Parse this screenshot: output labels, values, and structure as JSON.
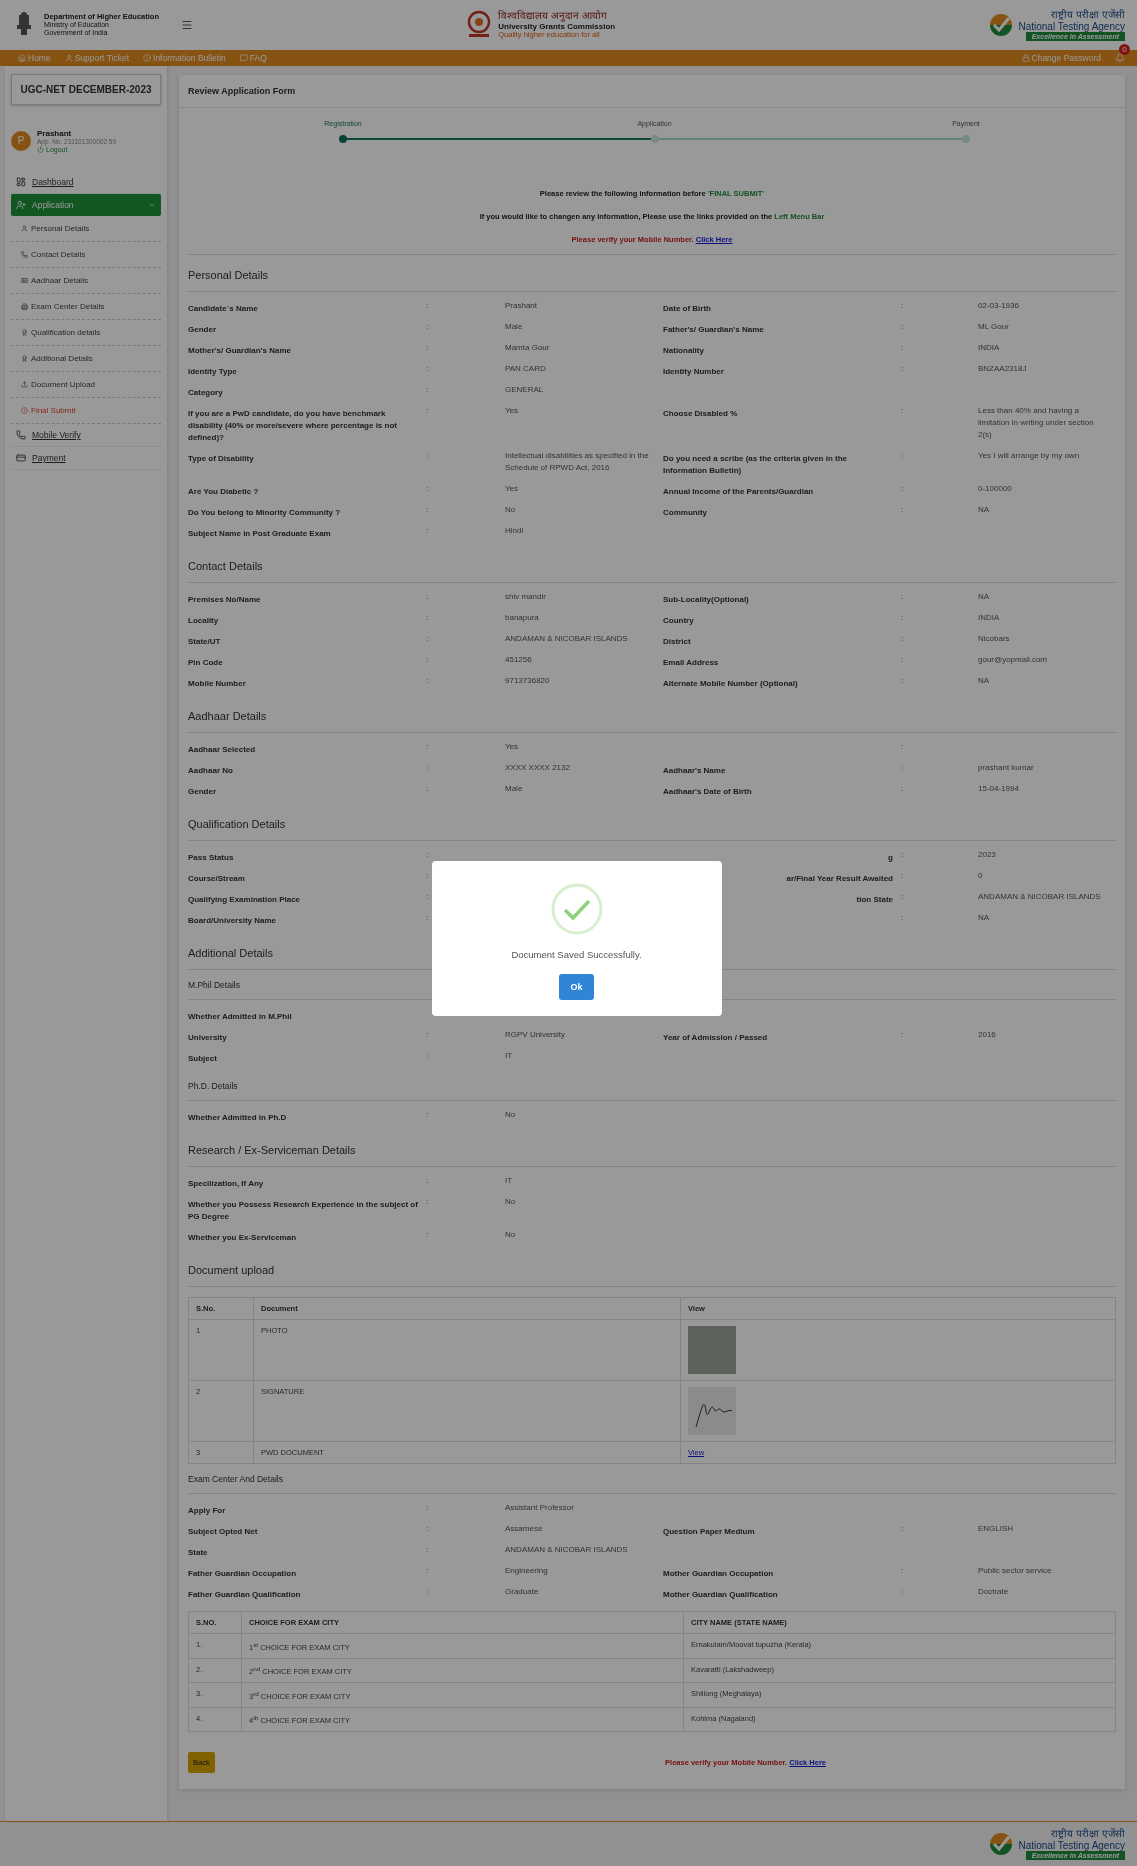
{
  "header": {
    "department": [
      "Department of Higher Education",
      "Ministry of Education",
      "Government of India"
    ],
    "center": {
      "hindi": "विश्वविद्यालय अनुदान आयोग",
      "name": "University Grants Commission",
      "tagline": "Quality higher education for all"
    },
    "right": {
      "hindi": "राष्ट्रीय परीक्षा एजेंसी",
      "name": "National Testing Agency",
      "tagline": "Excellence in Assessment"
    }
  },
  "nav": {
    "items": [
      {
        "label": "Home"
      },
      {
        "label": "Support Ticket"
      },
      {
        "label": "Information Bulletin"
      },
      {
        "label": "FAQ"
      }
    ],
    "change_password": "Change Password",
    "notifications": "0"
  },
  "sidebar": {
    "exam": "UGC-NET DECEMBER-2023",
    "user": {
      "name": "Prashant",
      "initial": "P",
      "app_no": "App. No. 231101300002 59",
      "logout": "Logout"
    },
    "items": [
      {
        "label": "Dashboard",
        "kind": "link",
        "selected": false
      },
      {
        "label": "Application",
        "kind": "group",
        "selected": true,
        "expanded": true,
        "children": [
          {
            "label": "Personal Details",
            "kind": "step"
          },
          {
            "label": "Contact Details",
            "kind": "step"
          },
          {
            "label": "Aadhaar Details",
            "kind": "step"
          },
          {
            "label": "Exam Center Details",
            "kind": "step"
          },
          {
            "label": "Qualification details",
            "kind": "step"
          },
          {
            "label": "Additional Details",
            "kind": "step"
          },
          {
            "label": "Document Upload",
            "kind": "step"
          },
          {
            "label": "Final Submit",
            "kind": "final"
          }
        ]
      },
      {
        "label": "Mobile Verify",
        "kind": "link",
        "selected": false
      },
      {
        "label": "Payment",
        "kind": "link",
        "selected": false
      }
    ]
  },
  "main": {
    "title": "Review Application Form",
    "steps": [
      {
        "label": "Registration",
        "completed": true
      },
      {
        "label": "Application",
        "completed": false
      },
      {
        "label": "Payment",
        "completed": false
      }
    ],
    "notices": [
      {
        "text": "Please review the following information before ",
        "highlight": "'FINAL SUBMIT'"
      },
      {
        "text": "If you would like to changen any information, Please use the links provided on the ",
        "highlight": "Left Menu Bar"
      }
    ],
    "verify": {
      "text": "Please verify your Mobile Number.",
      "link": "Click Here"
    },
    "sections": [
      {
        "kind": "section",
        "title": "Personal Details",
        "rows": [
          {
            "kind": "pair",
            "label": "Candidate`s Name",
            "sep": ":",
            "value": "Prashant",
            "label2": "Date of Birth",
            "sep2": ":",
            "value2": "02-03-1936"
          },
          {
            "kind": "pair",
            "label": "Gender",
            "sep": ":",
            "value": "Male",
            "label2": "Father's/ Guardian's Name",
            "sep2": ":",
            "value2": "ML Gour"
          },
          {
            "kind": "pair",
            "label": "Mother's/ Guardian's Name",
            "sep": ":",
            "value": "Mamta Gour",
            "label2": "Nationality",
            "sep2": ":",
            "value2": "INDIA"
          },
          {
            "kind": "pair",
            "label": "Identity Type",
            "sep": ":",
            "value": "PAN CARD",
            "label2": "Identity Number",
            "sep2": ":",
            "value2": "BNZAA2318J"
          },
          {
            "kind": "single",
            "label": "Category",
            "sep": ":",
            "value": "GENERAL"
          },
          {
            "kind": "pair",
            "label": "If you are a PwD candidate, do you have benchmark disability (40% or more/severe where percentage is not defined)?",
            "sep": ":",
            "value": "Yes",
            "label2": "Choose Disabled %",
            "sep2": ":",
            "value2": "Less than 40% and having a limitation in writing under section 2(s)"
          },
          {
            "kind": "pair",
            "label": "Type of Disability",
            "sep": ":",
            "value": "Intellectual disabilities as specified in the Schedule of RPWD Act, 2016",
            "label2": "Do you need a scribe (as the criteria given in the Information Bulletin)",
            "sep2": ":",
            "value2": "Yes I will arrange by my own"
          },
          {
            "kind": "pair",
            "label": "Are You Diabetic ?",
            "sep": ":",
            "value": "Yes",
            "label2": "Annual Income of the Parents/Guardian",
            "sep2": ":",
            "value2": "0-100000"
          },
          {
            "kind": "pair",
            "label": "Do You belong to Minority Community ?",
            "sep": ":",
            "value": "No",
            "label2": "Community",
            "sep2": ":",
            "value2": "NA"
          },
          {
            "kind": "single",
            "label": "Subject Name in Post Graduate Exam",
            "sep": ":",
            "value": "Hindi"
          }
        ]
      },
      {
        "kind": "section",
        "title": "Contact Details",
        "rows": [
          {
            "kind": "pair",
            "label": "Premises No/Name",
            "sep": ":",
            "value": "shiv mandir",
            "label2": "Sub-Locality(Optional)",
            "sep2": ":",
            "value2": "NA"
          },
          {
            "kind": "pair",
            "label": "Locality",
            "sep": ":",
            "value": "banapura",
            "label2": "Country",
            "sep2": ":",
            "value2": "INDIA"
          },
          {
            "kind": "pair",
            "label": "State/UT",
            "sep": ":",
            "value": "ANDAMAN & NICOBAR ISLANDS",
            "label2": "District",
            "sep2": ":",
            "value2": "Nicobars"
          },
          {
            "kind": "pair",
            "label": "Pin Code",
            "sep": ":",
            "value": "451256",
            "label2": "Email Address",
            "sep2": ":",
            "value2": "gour@yopmail.com"
          },
          {
            "kind": "pair",
            "label": "Mobile Number",
            "sep": ":",
            "value": "9713736820",
            "label2": "Alternate Mobile Number (Optional)",
            "sep2": ":",
            "value2": "NA"
          }
        ]
      },
      {
        "kind": "section",
        "title": "Aadhaar Details",
        "rows": [
          {
            "kind": "pair",
            "label": "Aadhaar Selected",
            "sep": ":",
            "value": "Yes",
            "sep2": ":"
          },
          {
            "kind": "pair",
            "label": "Aadhaar No",
            "sep": ":",
            "value": "XXXX XXXX 2132",
            "label2": "Aadhaar's Name",
            "sep2": ":",
            "value2": "prashant kumar"
          },
          {
            "kind": "pair",
            "label": "Gender",
            "sep": ":",
            "value": "Male",
            "label2": "Aadhaar's Date of Birth",
            "sep2": ":",
            "value2": "15-04-1994"
          }
        ]
      },
      {
        "kind": "section",
        "title": "Qualification Details",
        "rows": [
          {
            "kind": "covered",
            "label": "Pass Status",
            "sep": ":",
            "label2": "g",
            "sep2": ":",
            "value2": "2023"
          },
          {
            "kind": "covered",
            "label": "Course/Stream",
            "sep": ":",
            "label2": "ar/Final Year Result Awaited",
            "sep2": ":",
            "value2": "0"
          },
          {
            "kind": "covered",
            "label": "Qualifying Examination Place",
            "sep": ":",
            "label2": "tion State",
            "sep2": ":",
            "value2": "ANDAMAN & NICOBAR ISLANDS"
          },
          {
            "kind": "covered",
            "label": "Board/University Name",
            "sep": ":",
            "sep2": ":",
            "value2": "NA"
          }
        ]
      },
      {
        "kind": "section",
        "title": "Additional Details"
      },
      {
        "kind": "subsection",
        "title": "M.Phil Details",
        "rows": [
          {
            "kind": "covered",
            "label": "Whether Admitted in M.Phil"
          },
          {
            "kind": "pair",
            "label": "University",
            "sep": ":",
            "value": "RGPV University",
            "label2": "Year of Admission / Passed",
            "sep2": ":",
            "value2": "2016"
          },
          {
            "kind": "single",
            "label": "Subject",
            "sep": ":",
            "value": "IT"
          }
        ]
      },
      {
        "kind": "subsection",
        "title": "Ph.D. Details",
        "rows": [
          {
            "kind": "single",
            "label": "Whether Admitted in Ph.D",
            "sep": ":",
            "value": "No"
          }
        ]
      },
      {
        "kind": "section",
        "title": "Research / Ex-Serviceman Details",
        "rows": [
          {
            "kind": "single",
            "label": "Specilization, If Any",
            "sep": ":",
            "value": "IT"
          },
          {
            "kind": "single",
            "label": "Whether you Possess Research Experience in the subject of PG Degree",
            "sep": ":",
            "value": "No"
          },
          {
            "kind": "single",
            "label": "Whether you Ex-Serviceman",
            "sep": ":",
            "value": "No"
          }
        ]
      },
      {
        "kind": "documents",
        "title": "Document upload",
        "columns": [
          "S.No.",
          "Document",
          "View"
        ],
        "rows": [
          {
            "sno": "1",
            "document": "PHOTO",
            "view": {
              "kind": "photo"
            }
          },
          {
            "sno": "2",
            "document": "SIGNATURE",
            "view": {
              "kind": "signature"
            }
          },
          {
            "sno": "3",
            "document": "PWD DOCUMENT",
            "view": {
              "kind": "link",
              "text": "View"
            }
          }
        ]
      },
      {
        "kind": "subsection",
        "title": "Exam Center And Details",
        "rows": [
          {
            "kind": "single",
            "label": "Apply For",
            "sep": ":",
            "value": "Assistant Professor"
          },
          {
            "kind": "pair",
            "label": "Subject Opted Net",
            "sep": ":",
            "value": "Assamese",
            "label2": "Question Paper Medium",
            "sep2": ":",
            "value2": "ENGLISH"
          },
          {
            "kind": "single",
            "label": "State",
            "sep": ":",
            "value": "ANDAMAN & NICOBAR ISLANDS"
          },
          {
            "kind": "pair",
            "label": "Father Guardian Occupation",
            "sep": ":",
            "value": "Engineering",
            "label2": "Mother Guardian Occupation",
            "sep2": ":",
            "value2": "Public sector service"
          },
          {
            "kind": "pair",
            "label": "Father Guardian Qualification",
            "sep": ":",
            "value": "Graduate",
            "label2": "Mother Guardian Qualification",
            "sep2": ":",
            "value2": "Doctrate"
          }
        ]
      },
      {
        "kind": "cities",
        "columns": [
          "S.NO.",
          "CHOICE FOR EXAM CITY",
          "CITY NAME (STATE NAME)"
        ],
        "rows": [
          {
            "sno": "1.",
            "choice": "1$^{st}$ CHOICE FOR EXAM CITY",
            "city": "Ernakulam/Moovat tupuzha (Kerala)"
          },
          {
            "sno": "2.",
            "choice": "2$^{nd}$ CHOICE FOR EXAM CITY",
            "city": "Kavaratti (Lakshadweep)"
          },
          {
            "sno": "3.",
            "choice": "3$^{rd}$ CHOICE FOR EXAM CITY",
            "city": "Shillong (Meghalaya)"
          },
          {
            "sno": "4.",
            "choice": "4$^{th}$ CHOICE FOR EXAM CITY",
            "city": "Kohima (Nagaland)"
          }
        ]
      }
    ],
    "back": "Back",
    "verify_bottom": {
      "text": "Please verify your Mobile Number.",
      "link": "Click Here"
    }
  },
  "footer": {
    "hindi": "राष्ट्रीय परीक्षा एजेंसी",
    "name": "National Testing Agency",
    "tagline": "Excellence in Assessment"
  },
  "modal": {
    "message": "Document Saved Successfully.",
    "button": "Ok"
  }
}
